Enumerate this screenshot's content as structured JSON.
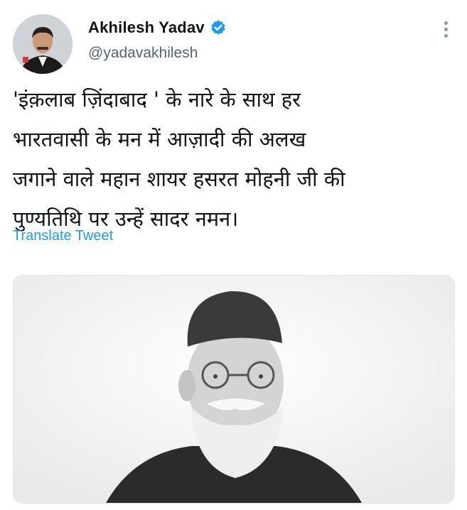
{
  "tweet": {
    "author_name": "Akhilesh Yadav",
    "handle": "@yadavakhilesh",
    "verified_icon": "verified-badge-icon",
    "more_icon": "more-options-icon",
    "text": "'इंक़लाब ज़िंदाबाद ' के नारे के साथ हर\nभारतवासी के मन में आज़ादी की अलख\nजगाने वाले महान शायर हसरत मोहनी जी की\nपुण्यतिथि पर उन्हें सादर नमन।",
    "translate_label": "Translate Tweet",
    "media_kind": "photo"
  },
  "colors": {
    "accent": "#1d9bf0",
    "text_primary": "#0f1419",
    "text_secondary": "#536471"
  }
}
